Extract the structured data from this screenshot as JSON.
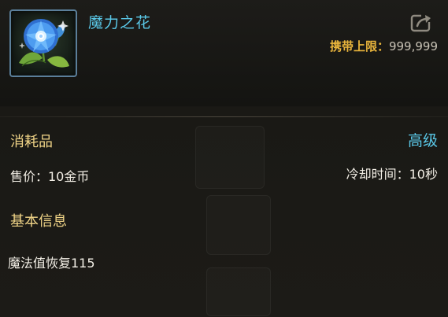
{
  "item": {
    "name": "魔力之花",
    "icon": "blue-flower-icon",
    "carry_limit_label": "携带上限：",
    "carry_limit_value": "999,999"
  },
  "details": {
    "category": "消耗品",
    "grade": "高级",
    "price": "售价：10金币",
    "cooldown": "冷却时间：10秒"
  },
  "basic_info": {
    "title": "基本信息",
    "effect": "魔法值恢复115"
  },
  "colors": {
    "name": "#5ac8e8",
    "grade": "#5ac8e8",
    "section_title": "#f0d487",
    "carry_label": "#e8b43c"
  }
}
